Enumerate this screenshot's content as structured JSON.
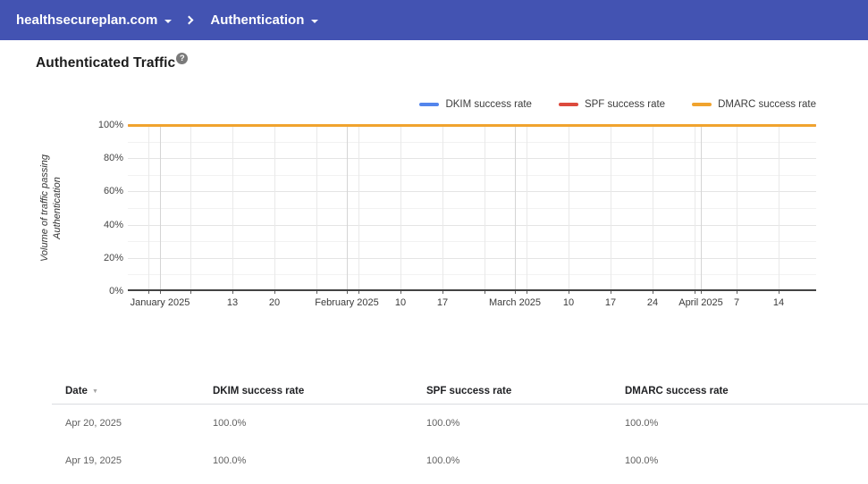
{
  "topbar": {
    "bar_color": "#4353b2",
    "domain_label": "healthsecureplan.com",
    "chevron_glyph": "›",
    "section_label": "Authentication"
  },
  "page": {
    "title": "Authenticated Traffic",
    "help_glyph": "?"
  },
  "chart_data": {
    "type": "line",
    "title": "Authenticated Traffic",
    "ylabel": "Volume of traffic passing Authentication",
    "ylabel_line1": "Volume of traffic passing",
    "ylabel_line2": "Authentication",
    "ylim": [
      0,
      100
    ],
    "grid": true,
    "legend_position": "top-right",
    "y_major_ticks": [
      {
        "label": "100%",
        "value": 100
      },
      {
        "label": "80%",
        "value": 80
      },
      {
        "label": "60%",
        "value": 60
      },
      {
        "label": "40%",
        "value": 40
      },
      {
        "label": "20%",
        "value": 20
      },
      {
        "label": "0%",
        "value": 0
      }
    ],
    "y_minor_tick_values": [
      90,
      70,
      50,
      30,
      10
    ],
    "x_ticks": [
      {
        "label": "",
        "pos": 23,
        "month": false
      },
      {
        "label": "January 2025",
        "pos": 36,
        "month": true
      },
      {
        "label": "",
        "pos": 70,
        "month": false
      },
      {
        "label": "13",
        "pos": 117,
        "month": false
      },
      {
        "label": "20",
        "pos": 164,
        "month": false
      },
      {
        "label": "",
        "pos": 211,
        "month": false
      },
      {
        "label": "February 2025",
        "pos": 245,
        "month": true
      },
      {
        "label": "",
        "pos": 258,
        "month": false
      },
      {
        "label": "10",
        "pos": 305,
        "month": false
      },
      {
        "label": "17",
        "pos": 352,
        "month": false
      },
      {
        "label": "",
        "pos": 399,
        "month": false
      },
      {
        "label": "March 2025",
        "pos": 433,
        "month": true
      },
      {
        "label": "",
        "pos": 446,
        "month": false
      },
      {
        "label": "10",
        "pos": 493,
        "month": false
      },
      {
        "label": "17",
        "pos": 540,
        "month": false
      },
      {
        "label": "24",
        "pos": 587,
        "month": false
      },
      {
        "label": "",
        "pos": 634,
        "month": false
      },
      {
        "label": "April 2025",
        "pos": 641,
        "month": true
      },
      {
        "label": "7",
        "pos": 681,
        "month": false
      },
      {
        "label": "14",
        "pos": 728,
        "month": false
      }
    ],
    "series": [
      {
        "name": "DKIM success rate",
        "color": "#5385ec",
        "constant_value_percent": 100
      },
      {
        "name": "SPF success rate",
        "color": "#dc4a3d",
        "constant_value_percent": 100
      },
      {
        "name": "DMARC success rate",
        "color": "#f0a32e",
        "constant_value_percent": 100
      }
    ]
  },
  "table": {
    "columns": [
      "Date",
      "DKIM success rate",
      "SPF success rate",
      "DMARC success rate"
    ],
    "sort_column_index": 0,
    "sort_indicator": "▼",
    "rows": [
      [
        "Apr 20, 2025",
        "100.0%",
        "100.0%",
        "100.0%"
      ],
      [
        "Apr 19, 2025",
        "100.0%",
        "100.0%",
        "100.0%"
      ]
    ]
  }
}
